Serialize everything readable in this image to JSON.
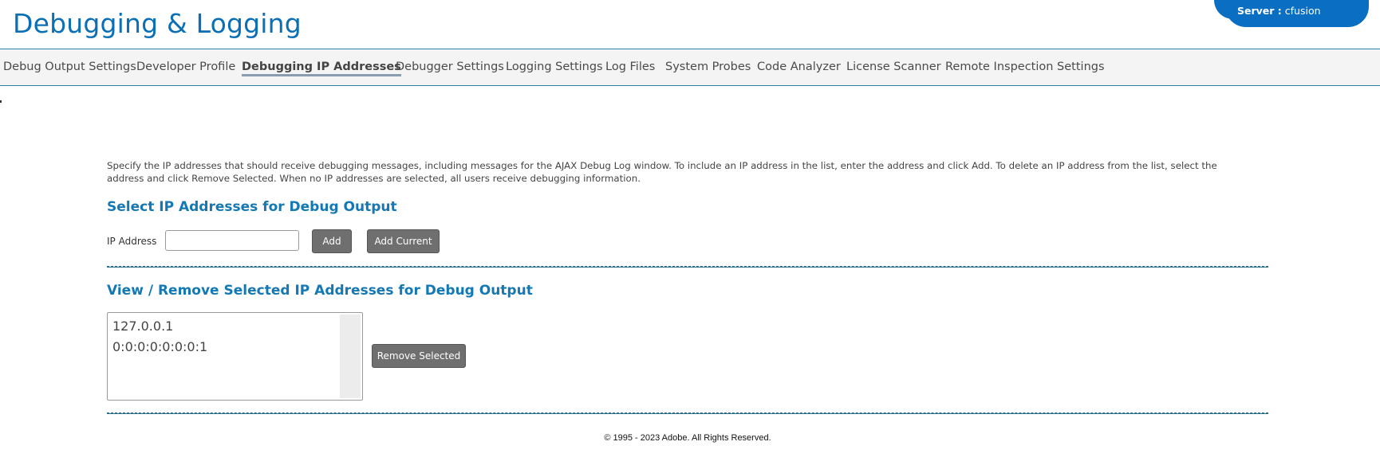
{
  "header": {
    "title": "Debugging & Logging",
    "server_label": "Server :",
    "server_name": "cfusion"
  },
  "nav": {
    "items": [
      {
        "label": "Debug Output Settings",
        "active": false
      },
      {
        "label": "Developer Profile",
        "active": false
      },
      {
        "label": "Debugging IP Addresses",
        "active": true
      },
      {
        "label": "Debugger Settings",
        "active": false
      },
      {
        "label": "Logging Settings",
        "active": false
      },
      {
        "label": "Log Files",
        "active": false
      },
      {
        "label": "System Probes",
        "active": false
      },
      {
        "label": "Code Analyzer",
        "active": false
      },
      {
        "label": "License Scanner",
        "active": false
      },
      {
        "label": "Remote Inspection Settings",
        "active": false
      }
    ]
  },
  "main": {
    "intro": "Specify the IP addresses that should receive debugging messages, including messages for the AJAX Debug Log window. To include an IP address in the list, enter the address and click Add. To delete an IP address from the list, select the address and click Remove Selected. When no IP addresses are selected, all users receive debugging information.",
    "select_section": {
      "heading": "Select IP Addresses for Debug Output",
      "ip_label": "IP Address",
      "ip_value": "",
      "add_label": "Add",
      "add_current_label": "Add Current"
    },
    "view_section": {
      "heading": "View / Remove Selected IP Addresses for Debug Output",
      "ip_list": [
        "127.0.0.1",
        "0:0:0:0:0:0:0:1"
      ],
      "remove_label": "Remove Selected"
    }
  },
  "footer": {
    "copyright": "© 1995 - 2023 Adobe. All Rights Reserved."
  },
  "colors": {
    "brand_blue": "#0b6fb6",
    "server_badge": "#0a6fc2",
    "button_gray": "#6f6f6f",
    "heading_blue": "#1478b4"
  }
}
